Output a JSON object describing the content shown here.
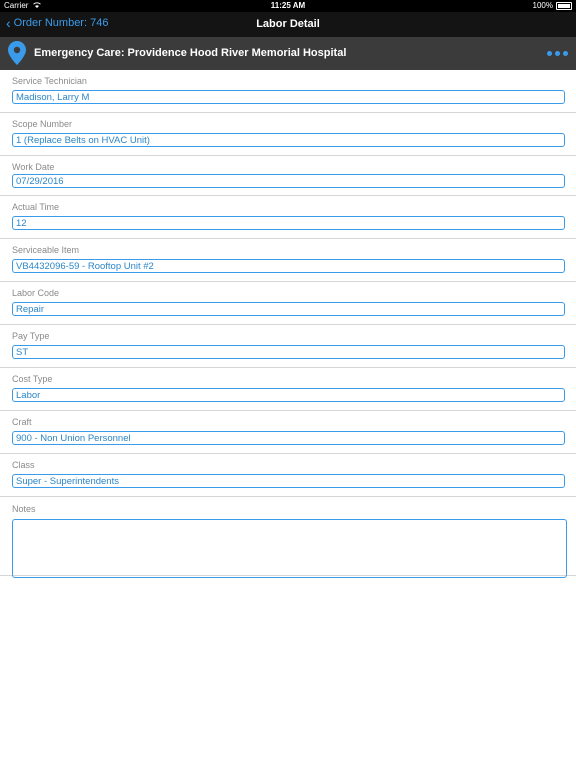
{
  "status_bar": {
    "carrier": "Carrier",
    "time": "11:25 AM",
    "battery": "100%"
  },
  "nav": {
    "back_label": "Order Number: 746",
    "title": "Labor Detail"
  },
  "location": {
    "title": "Emergency Care: Providence Hood River Memorial Hospital"
  },
  "fields": [
    {
      "label": "Service Technician",
      "value": "Madison, Larry M"
    },
    {
      "label": "Scope Number",
      "value": "1 (Replace Belts on HVAC Unit)"
    },
    {
      "label": "Work Date",
      "value": "07/29/2016"
    },
    {
      "label": "Actual Time",
      "value": "12"
    },
    {
      "label": "Serviceable Item",
      "value": "VB4432096-59 - Rooftop Unit #2"
    },
    {
      "label": "Labor Code",
      "value": "Repair"
    },
    {
      "label": "Pay Type",
      "value": "ST"
    },
    {
      "label": "Cost Type",
      "value": "Labor"
    },
    {
      "label": "Craft",
      "value": "900 - Non Union Personnel"
    },
    {
      "label": "Class",
      "value": "Super - Superintendents"
    }
  ],
  "notes": {
    "label": "Notes",
    "value": ""
  },
  "colors": {
    "accent": "#3a9bea",
    "navbar": "#141414",
    "location_bar": "#3b3b3b"
  }
}
